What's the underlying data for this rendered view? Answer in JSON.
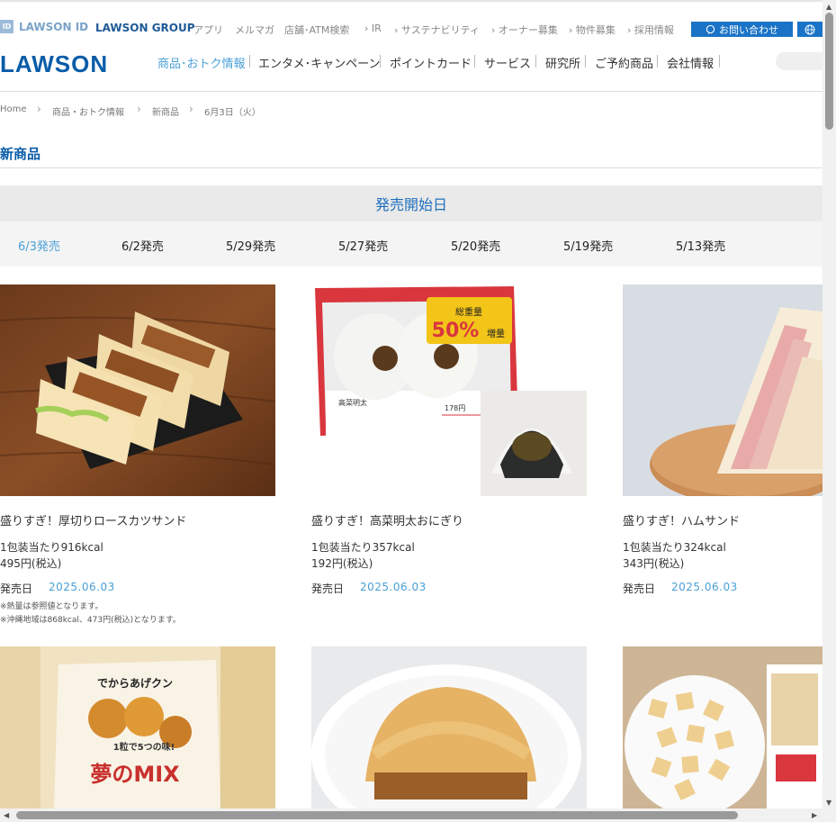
{
  "topbar": {
    "lawson_id": "LAWSON ID",
    "lawson_id_badge": "ID",
    "lawson_group": "LAWSON GROUP",
    "links": [
      "アプリ",
      "メルマガ",
      "店舗･ATM検索"
    ],
    "arrow_links": [
      "IR",
      "サステナビリティ",
      "オーナー募集",
      "物件募集",
      "採用情報"
    ],
    "contact_label": "お問い合わせ"
  },
  "header": {
    "logo": "LAWSON",
    "nav": [
      "商品･おトク情報",
      "エンタメ･キャンペーン",
      "ポイントカード",
      "サービス",
      "研究所",
      "ご予約商品",
      "会社情報"
    ]
  },
  "breadcrumb": [
    "Home",
    "商品・おトク情報",
    "新商品",
    "6月3日（火）"
  ],
  "page_title": "新商品",
  "date_section_title": "発売開始日",
  "date_tabs": [
    "6/3発売",
    "6/2発売",
    "5/29発売",
    "5/27発売",
    "5/20発売",
    "5/19発売",
    "5/13発売"
  ],
  "date_label": "発売日",
  "products": [
    {
      "name": "盛りすぎ！厚切りロースカツサンド",
      "calories": "1包装当たり916kcal",
      "price": "495円(税込)",
      "date": "2025.06.03",
      "notes": [
        "※熱量は参照値となります。",
        "※沖縄地域は868kcal、473円(税込)となります。"
      ]
    },
    {
      "name": "盛りすぎ！高菜明太おにぎり",
      "calories": "1包装当たり357kcal",
      "price": "192円(税込)",
      "date": "2025.06.03",
      "package_text": [
        "総重量",
        "50%",
        "増量",
        "高菜明太",
        "178円"
      ]
    },
    {
      "name": "盛りすぎ！ハムサンド",
      "calories": "1包装当たり324kcal",
      "price": "343円(税込)",
      "date": "2025.06.03"
    }
  ],
  "lower_products": [
    {
      "package_text": [
        "でからあげクン",
        "1粒で5つの味!",
        "夢のMIX"
      ]
    },
    {},
    {}
  ]
}
